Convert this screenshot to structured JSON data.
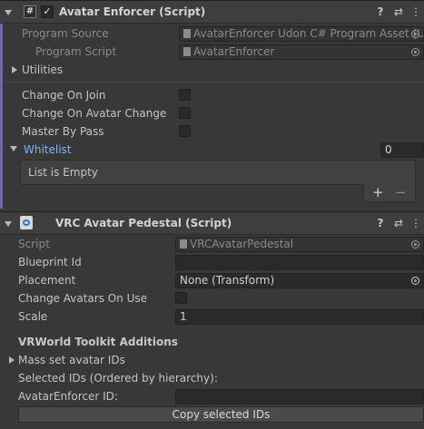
{
  "avatar_enforcer": {
    "title": "Avatar Enforcer (Script)",
    "program_source_label": "Program Source",
    "program_source_value": "AvatarEnforcer Udon C# Program Asset (U",
    "program_script_label": "Program Script",
    "program_script_value": "AvatarEnforcer",
    "utilities_label": "Utilities",
    "change_on_join_label": "Change On Join",
    "change_on_avatar_change_label": "Change On Avatar Change",
    "master_by_pass_label": "Master By Pass",
    "whitelist_label": "Whitelist",
    "whitelist_count": "0",
    "list_empty_text": "List is Empty",
    "add_symbol": "+",
    "remove_symbol": "−"
  },
  "vrc_pedestal": {
    "title": "VRC Avatar Pedestal (Script)",
    "script_label": "Script",
    "script_value": "VRCAvatarPedestal",
    "blueprint_id_label": "Blueprint Id",
    "blueprint_id_value": "",
    "placement_label": "Placement",
    "placement_value": "None (Transform)",
    "change_avatars_on_use_label": "Change Avatars On Use",
    "scale_label": "Scale",
    "scale_value": "1"
  },
  "toolkit": {
    "heading": "VRWorld Toolkit Additions",
    "mass_set_label": "Mass set avatar IDs",
    "selected_ids_label": "Selected IDs (Ordered by hierarchy):",
    "avatar_enforcer_id_label": "AvatarEnforcer ID:",
    "avatar_enforcer_id_value": "",
    "copy_button_label": "Copy selected IDs"
  },
  "icons": {
    "hash": "#",
    "check": "✓",
    "help": "?",
    "settings": "⇄",
    "more": "⋮",
    "chevron": "▾"
  },
  "colors": {
    "accent_blue": "#7ab4ff",
    "selection_bar": "#6a6aa0"
  }
}
